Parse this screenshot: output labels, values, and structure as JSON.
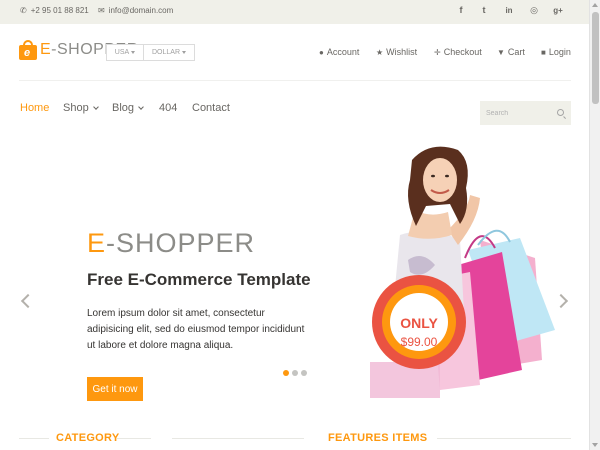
{
  "topbar": {
    "phone": "+2 95 01 88 821",
    "email": "info@domain.com",
    "social_icons": [
      "facebook-icon",
      "twitter-icon",
      "linkedin-icon",
      "dribbble-icon",
      "google-plus-icon"
    ],
    "social_glyphs": [
      "f",
      "t",
      "in",
      "◎",
      "g+"
    ]
  },
  "header": {
    "logo_letter": "e",
    "logo_accent": "E",
    "logo_rest": "-SHOPPER",
    "currency_country": "USA",
    "currency_unit": "DOLLAR",
    "user_menu": [
      "Account",
      "Wishlist",
      "Checkout",
      "Cart",
      "Login"
    ]
  },
  "nav": {
    "items": [
      "Home",
      "Shop",
      "Blog",
      "404",
      "Contact"
    ],
    "active": "Home",
    "search_placeholder": "Search"
  },
  "slider": {
    "brand_accent": "E",
    "brand_rest": "-SHOPPER",
    "title": "Free E-Commerce Template",
    "text": "Lorem ipsum dolor sit amet, consectetur adipisicing elit, sed do eiusmod tempor incididunt ut labore et dolore magna aliqua.",
    "cta": "Get it now",
    "badge_label": "ONLY",
    "badge_price": "$99.00",
    "total_slides": 3,
    "active_slide": 1
  },
  "sections": {
    "category": "CATEGORY",
    "features": "FEATURES ITEMS"
  },
  "colors": {
    "accent": "#FE980F",
    "topbar_bg": "#F0F0E9",
    "badge_red": "#EA5342",
    "text_dark": "#363432"
  }
}
